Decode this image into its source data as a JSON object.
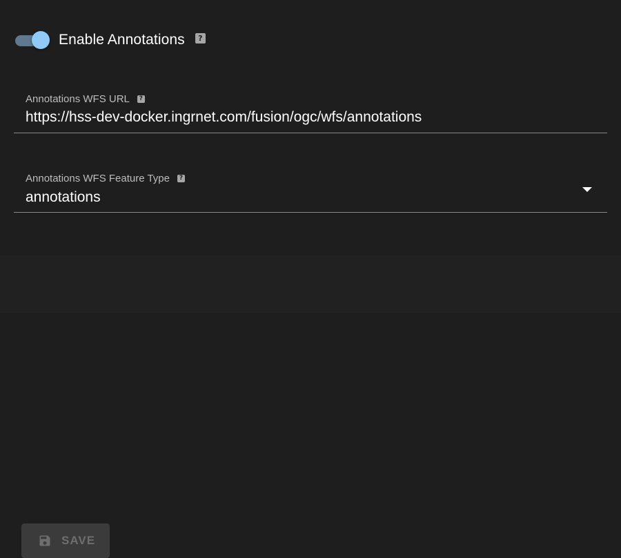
{
  "annotations": {
    "enabled": true,
    "toggle_label": "Enable Annotations",
    "help_glyph": "?"
  },
  "wfs_url_field": {
    "label": "Annotations WFS URL",
    "value": "https://hss-dev-docker.ingrnet.com/fusion/ogc/wfs/annotations",
    "help_glyph": "?"
  },
  "feature_type_field": {
    "label": "Annotations WFS Feature Type",
    "value": "annotations",
    "help_glyph": "?"
  },
  "footer": {
    "save_label": "SAVE",
    "save_enabled": false
  },
  "colors": {
    "background": "#1e1e1e",
    "toggle_thumb": "#90caf9",
    "toggle_track": "#5f7991",
    "disabled_button": "#3b3b3b",
    "disabled_text": "#6e6e6e"
  }
}
